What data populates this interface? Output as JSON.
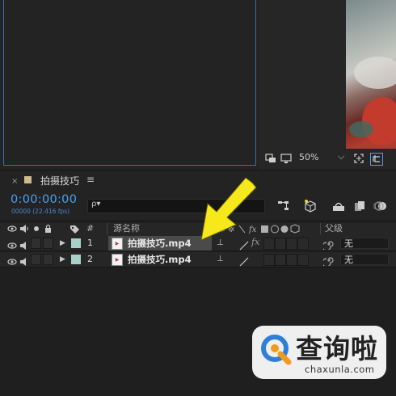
{
  "viewer": {
    "zoom": "50%",
    "zoom_dropdown_arrow": "⌵"
  },
  "composition_tab": {
    "close": "×",
    "title": "拍摄技巧",
    "menu": "≡"
  },
  "timeline": {
    "timecode": "0:00:00:00",
    "frames": "00000 (22.416 fps)",
    "search_placeholder": "",
    "search_icon": "ρ▾"
  },
  "columns": {
    "number": "#",
    "source_name": "源名称",
    "parent": "父级"
  },
  "layers": [
    {
      "number": "1",
      "name": "拍摄技巧.mp4",
      "parent": "无",
      "selected": true
    },
    {
      "number": "2",
      "name": "拍摄技巧.mp4",
      "parent": "无",
      "selected": false
    }
  ],
  "watermark": {
    "title": "查询啦",
    "url": "chaxunla.com"
  },
  "colors": {
    "timecode": "#4a9ff5",
    "label_swatch": "#a9cfc9",
    "comp_swatch": "#d1b98a",
    "arrow": "#f7e81c",
    "watermark_brand": "#2f7fd6"
  },
  "icons": [
    "eye-icon",
    "audio-icon",
    "solo-icon",
    "lock-icon",
    "label-tag-icon",
    "expand-triangle-icon",
    "pick-whip-icon",
    "fx-icon",
    "search-icon",
    "graph-editor-icon",
    "draft-3d-icon"
  ]
}
